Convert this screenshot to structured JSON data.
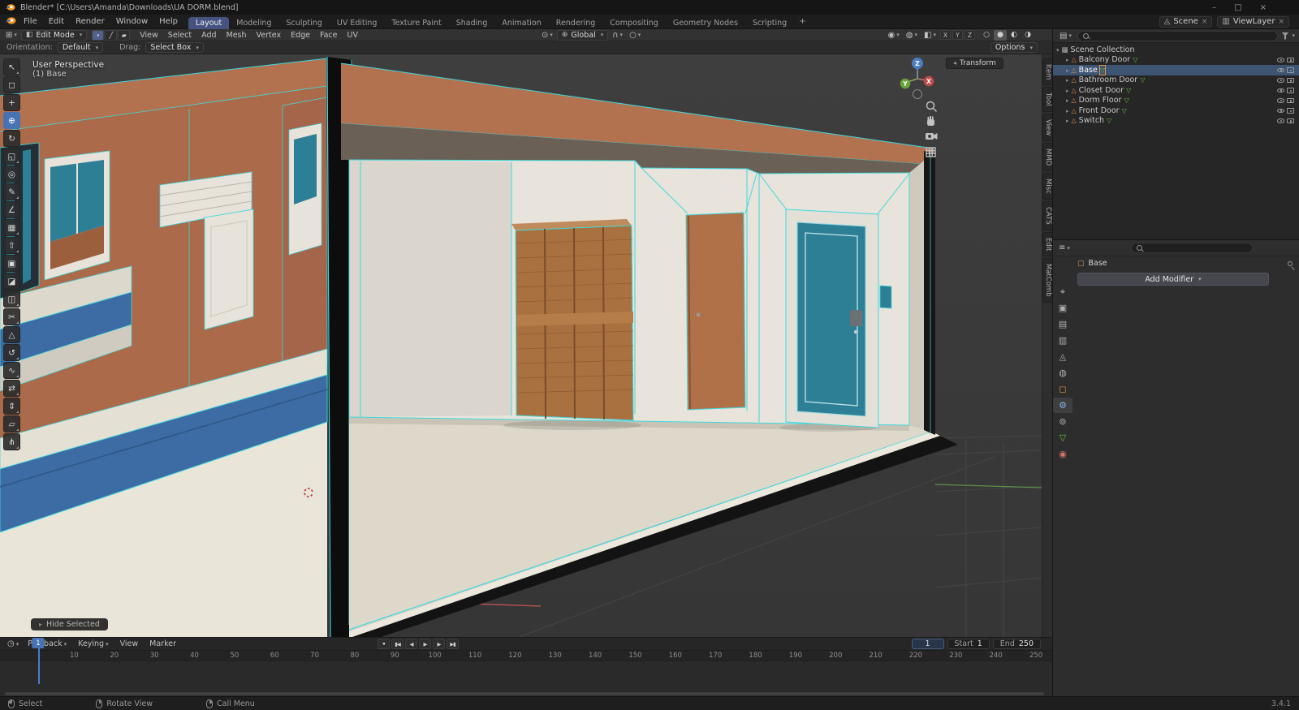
{
  "colors": {
    "accent": "#4772b3",
    "edit_mode_highlight": "#3fd8de",
    "wall_salmon": "#b2714f",
    "door_teal": "#2d7f95",
    "railing_blue": "#3c6ca3",
    "interior_white": "#e8e4db",
    "floor_beige": "#ddd8ca",
    "closet_wood": "#a9713f"
  },
  "window": {
    "title": "Blender* [C:\\Users\\Amanda\\Downloads\\UA DORM.blend]",
    "minimize": "–",
    "maximize": "□",
    "close": "×"
  },
  "topbar": {
    "menus": [
      "File",
      "Edit",
      "Render",
      "Window",
      "Help"
    ],
    "workspaces": [
      {
        "label": "Layout",
        "active": true
      },
      {
        "label": "Modeling"
      },
      {
        "label": "Sculpting"
      },
      {
        "label": "UV Editing"
      },
      {
        "label": "Texture Paint"
      },
      {
        "label": "Shading"
      },
      {
        "label": "Animation"
      },
      {
        "label": "Rendering"
      },
      {
        "label": "Compositing"
      },
      {
        "label": "Geometry Nodes"
      },
      {
        "label": "Scripting"
      }
    ],
    "add_tab": "+",
    "scene": "Scene",
    "view_layer": "ViewLayer",
    "unlink": "×"
  },
  "viewport_header": {
    "mode": "Edit Mode",
    "menus": [
      "View",
      "Select",
      "Add",
      "Mesh",
      "Vertex",
      "Edge",
      "Face",
      "UV"
    ],
    "orientation": "Global",
    "axis_toggles": [
      "X",
      "Y",
      "Z"
    ],
    "shading_modes": [
      "○",
      "●",
      "◐",
      "◑"
    ]
  },
  "tool_settings": {
    "orientation_label": "Orientation:",
    "orientation_value": "Default",
    "drag_label": "Drag:",
    "drag_value": "Select Box",
    "options": "Options"
  },
  "toolbar": {
    "tools": [
      {
        "name": "tweak",
        "glyph": "↖",
        "group": true
      },
      {
        "name": "select-box",
        "glyph": "◻"
      },
      {
        "name": "cursor",
        "glyph": "+"
      },
      {
        "name": "move",
        "glyph": "⊕",
        "active": true
      },
      {
        "name": "rotate",
        "glyph": "↻"
      },
      {
        "name": "scale",
        "glyph": "◱",
        "group": true
      },
      {
        "name": "transform",
        "glyph": "◎"
      },
      {
        "name": "annotate",
        "glyph": "✎",
        "group": true
      },
      {
        "name": "measure",
        "glyph": "∠"
      },
      {
        "name": "add-cube",
        "glyph": "▦",
        "group": true
      },
      {
        "name": "extrude",
        "glyph": "⇧",
        "group": true
      },
      {
        "name": "inset",
        "glyph": "▣"
      },
      {
        "name": "bevel",
        "glyph": "◪"
      },
      {
        "name": "loop-cut",
        "glyph": "◫",
        "group": true
      },
      {
        "name": "knife",
        "glyph": "✂",
        "group": true
      },
      {
        "name": "poly-build",
        "glyph": "△"
      },
      {
        "name": "spin",
        "glyph": "↺",
        "group": true
      },
      {
        "name": "smooth",
        "glyph": "∿",
        "group": true
      },
      {
        "name": "edge-slide",
        "glyph": "⇄",
        "group": true
      },
      {
        "name": "shrink-fatten",
        "glyph": "⇕",
        "group": true
      },
      {
        "name": "shear",
        "glyph": "▱",
        "group": true
      },
      {
        "name": "rip-region",
        "glyph": "⋔",
        "group": true
      }
    ]
  },
  "viewport": {
    "perspective": "User Perspective",
    "active_object": "(1) Base",
    "transform_panel": "Transform",
    "operator_panel": "Hide Selected",
    "gizmo": {
      "x": "X",
      "y": "Y",
      "z": "Z"
    }
  },
  "npanel_tabs": [
    "Item",
    "Tool",
    "View",
    "MMD",
    "Misc",
    "CATS",
    "Edit",
    "MatComb"
  ],
  "outliner": {
    "scene_label": "Scene Collection",
    "items": [
      {
        "label": "Balcony Door"
      },
      {
        "label": "Base",
        "selected": true
      },
      {
        "label": "Bathroom Door"
      },
      {
        "label": "Closet Door"
      },
      {
        "label": "Dorm Floor"
      },
      {
        "label": "Front Door"
      },
      {
        "label": "Switch"
      }
    ]
  },
  "properties": {
    "tabs": [
      {
        "name": "tool",
        "glyph": "⌖",
        "color": "#c0c0c0"
      },
      {
        "name": "render",
        "glyph": "▣",
        "color": "#b0b0b0"
      },
      {
        "name": "output",
        "glyph": "▤",
        "color": "#b0b0b0"
      },
      {
        "name": "view-layer",
        "glyph": "▥",
        "color": "#b0b0b0"
      },
      {
        "name": "scene",
        "glyph": "◬",
        "color": "#b0b0b0"
      },
      {
        "name": "world",
        "glyph": "◍",
        "color": "#b0b0b0"
      },
      {
        "name": "object",
        "glyph": "◻",
        "color": "#e8923f"
      },
      {
        "name": "modifiers",
        "glyph": "⚙",
        "color": "#86b6ec",
        "active": true
      },
      {
        "name": "physics",
        "glyph": "⊚",
        "color": "#b0b0b0"
      },
      {
        "name": "object-data",
        "glyph": "▽",
        "color": "#6cbf3f"
      },
      {
        "name": "material",
        "glyph": "◉",
        "color": "#d4766a"
      }
    ],
    "breadcrumb_object": "Base",
    "add_modifier": "Add Modifier"
  },
  "timeline": {
    "menus": [
      "Playback",
      "Keying",
      "View",
      "Marker"
    ],
    "transport": [
      {
        "name": "auto-key",
        "glyph": "●"
      },
      {
        "name": "jump-start",
        "glyph": "▮◀"
      },
      {
        "name": "prev-keyframe",
        "glyph": "◀"
      },
      {
        "name": "play",
        "glyph": "▶"
      },
      {
        "name": "next-keyframe",
        "glyph": "▶"
      },
      {
        "name": "jump-end",
        "glyph": "▶▮"
      }
    ],
    "current_frame": "1",
    "start_label": "Start",
    "start_value": "1",
    "end_label": "End",
    "end_value": "250",
    "ticks": [
      10,
      20,
      30,
      40,
      50,
      60,
      70,
      80,
      90,
      100,
      110,
      120,
      130,
      140,
      150,
      160,
      170,
      180,
      190,
      200,
      210,
      220,
      230,
      240,
      250
    ]
  },
  "statusbar": {
    "select": "Select",
    "rotate_view": "Rotate View",
    "call_menu": "Call Menu",
    "version": "3.4.1"
  }
}
